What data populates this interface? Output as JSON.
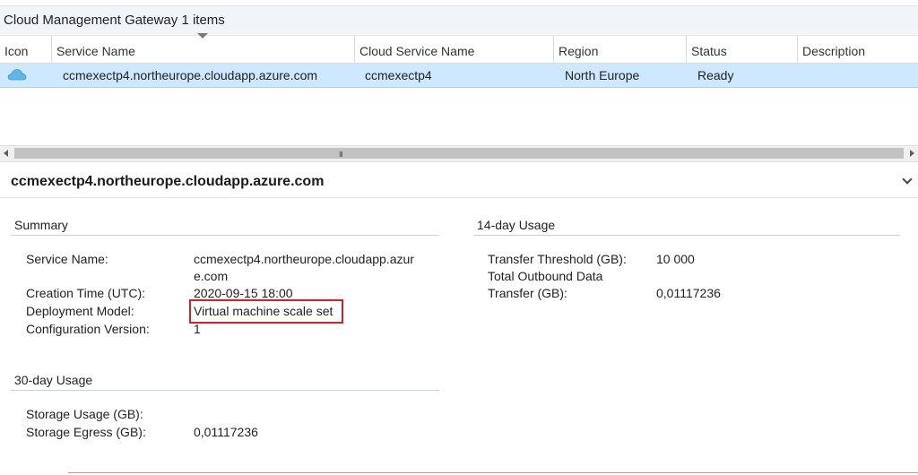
{
  "list": {
    "title": "Cloud Management Gateway 1 items",
    "columns": [
      "Icon",
      "Service Name",
      "Cloud Service Name",
      "Region",
      "Status",
      "Description"
    ],
    "rows": [
      {
        "icon": "cloud-icon",
        "service_name": "ccmexectp4.northeurope.cloudapp.azure.com",
        "cloud_service_name": "ccmexectp4",
        "region": "North Europe",
        "status": "Ready",
        "description": ""
      }
    ],
    "scroll_grip": "III"
  },
  "details": {
    "title": "ccmexectp4.northeurope.cloudapp.azure.com",
    "summary": {
      "heading": "Summary",
      "service_name_label": "Service Name:",
      "service_name_value_line1": "ccmexectp4.northeurope.cloudapp.azur",
      "service_name_value_line2": "e.com",
      "creation_time_label": "Creation Time (UTC):",
      "creation_time_value": "2020-09-15 18:00",
      "deployment_model_label": "Deployment Model:",
      "deployment_model_value": "Virtual machine scale set",
      "configuration_version_label": "Configuration Version:",
      "configuration_version_value": "1"
    },
    "usage_14": {
      "heading": "14-day Usage",
      "transfer_threshold_label": "Transfer Threshold (GB):",
      "transfer_threshold_value": "10 000",
      "total_outbound_label_line1": "Total Outbound Data",
      "total_outbound_label_line2": "Transfer (GB):",
      "total_outbound_value": "0,01117236"
    },
    "usage_30": {
      "heading": "30-day Usage",
      "storage_usage_label": "Storage Usage (GB):",
      "storage_usage_value": "",
      "storage_egress_label": "Storage Egress (GB):",
      "storage_egress_value": "0,01117236"
    }
  },
  "colors": {
    "selected_row": "#cde8ff",
    "header_band": "#f1f5fa",
    "highlight": "#d1222a",
    "cloud_icon": "#5fb8e4"
  }
}
